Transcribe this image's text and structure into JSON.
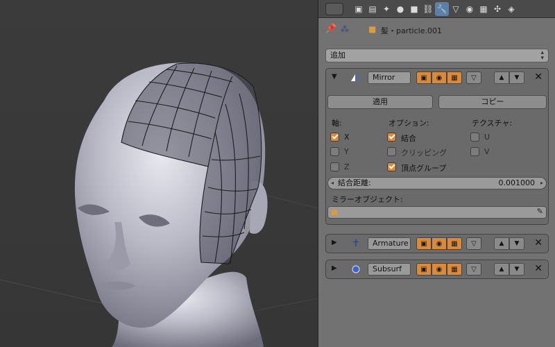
{
  "header": {
    "context_name": "髪・particle.001"
  },
  "add_modifier": {
    "label": "追加"
  },
  "modifiers": [
    {
      "name": "Mirror",
      "apply_label": "適用",
      "copy_label": "コピー",
      "axis_heading": "軸:",
      "options_heading": "オプション:",
      "textures_heading": "テクスチャ:",
      "axis": [
        {
          "label": "X",
          "checked": true
        },
        {
          "label": "Y",
          "checked": false
        },
        {
          "label": "Z",
          "checked": false
        }
      ],
      "options": [
        {
          "label": "結合",
          "checked": true
        },
        {
          "label": "クリッピング",
          "checked": false
        },
        {
          "label": "頂点グループ",
          "checked": true
        }
      ],
      "textures": [
        {
          "label": "U",
          "checked": false
        },
        {
          "label": "V",
          "checked": false
        }
      ],
      "merge_distance_label": "結合距離:",
      "merge_distance_value": "0.001000",
      "mirror_object_label": "ミラーオブジェクト:"
    },
    {
      "name": "Armature"
    },
    {
      "name": "Subsurf"
    }
  ],
  "colors": {
    "active_orange": "#d98a3d",
    "panel_bg": "#727272",
    "tab_active": "#5e7fa8"
  }
}
